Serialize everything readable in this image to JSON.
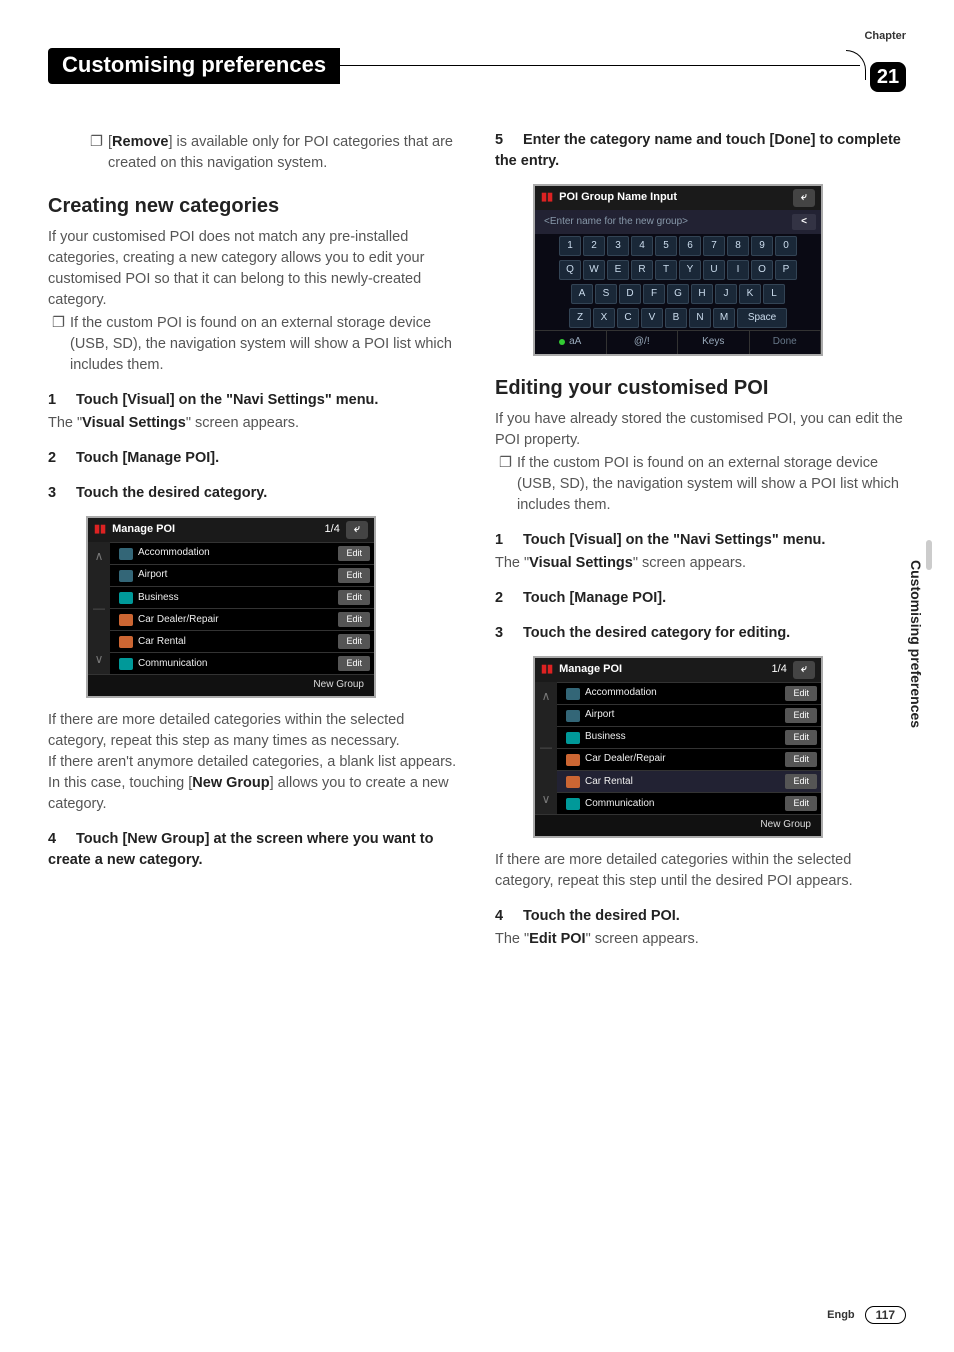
{
  "header": {
    "chapter_label": "Chapter",
    "title": "Customising preferences",
    "chapter_num": "21"
  },
  "col1": {
    "remove_note_prefix": "[",
    "remove_bold": "Remove",
    "remove_note_rest": "] is available only for POI categories that are created on this navigation system.",
    "heading1": "Creating new categories",
    "p1": "If your customised POI does not match any pre-installed categories, creating a new category allows you to edit your customised POI so that it can belong to this newly-created category.",
    "bullet1": "If the custom POI is found on an external storage device (USB, SD), the navigation system will show a POI list which includes them.",
    "step1": "Touch [Visual] on the \"Navi Settings\" menu.",
    "step1_note_a": "The \"",
    "step1_note_bold": "Visual Settings",
    "step1_note_b": "\" screen appears.",
    "step2": "Touch [Manage POI].",
    "step3": "Touch the desired category.",
    "shot1": {
      "title": "Manage POI",
      "page": "1/4",
      "rows": [
        {
          "label": "Accommodation",
          "btn": "Edit"
        },
        {
          "label": "Airport",
          "btn": "Edit"
        },
        {
          "label": "Business",
          "btn": "Edit"
        },
        {
          "label": "Car Dealer/Repair",
          "btn": "Edit"
        },
        {
          "label": "Car Rental",
          "btn": "Edit"
        },
        {
          "label": "Communication",
          "btn": "Edit"
        }
      ],
      "footer": "New Group"
    },
    "p2": "If there are more detailed categories within the selected category, repeat this step as many times as necessary.",
    "p3a": "If there aren't anymore detailed categories, a blank list appears. In this case, touching [",
    "p3bold": "New Group",
    "p3b": "] allows you to create a new category.",
    "step4": "Touch [New Group] at the screen where you want to create a new category."
  },
  "col2": {
    "step5": "Enter the category name and touch [Done] to complete the entry.",
    "kb": {
      "title": "POI Group Name Input",
      "placeholder": "<Enter name for the new group>",
      "row1": [
        "1",
        "2",
        "3",
        "4",
        "5",
        "6",
        "7",
        "8",
        "9",
        "0"
      ],
      "row2": [
        "Q",
        "W",
        "E",
        "R",
        "T",
        "Y",
        "U",
        "I",
        "O",
        "P"
      ],
      "row3": [
        "A",
        "S",
        "D",
        "F",
        "G",
        "H",
        "J",
        "K",
        "L"
      ],
      "row4": [
        "Z",
        "X",
        "C",
        "V",
        "B",
        "N",
        "M",
        "Space"
      ],
      "bottom": [
        "aA",
        "@/!",
        "Keys",
        "Done"
      ]
    },
    "heading2": "Editing your customised POI",
    "p4": "If you have already stored the customised POI, you can edit the POI property.",
    "bullet2": "If the custom POI is found on an external storage device (USB, SD), the navigation system will show a POI list which includes them.",
    "step1b": "Touch [Visual] on the \"Navi Settings\" menu.",
    "step1b_note_a": "The \"",
    "step1b_note_bold": "Visual Settings",
    "step1b_note_b": "\" screen appears.",
    "step2b": "Touch [Manage POI].",
    "step3b": "Touch the desired category for editing.",
    "shot2": {
      "title": "Manage POI",
      "page": "1/4",
      "rows": [
        {
          "label": "Accommodation",
          "btn": "Edit"
        },
        {
          "label": "Airport",
          "btn": "Edit"
        },
        {
          "label": "Business",
          "btn": "Edit"
        },
        {
          "label": "Car Dealer/Repair",
          "btn": "Edit"
        },
        {
          "label": "Car Rental",
          "btn": "Edit"
        },
        {
          "label": "Communication",
          "btn": "Edit"
        }
      ],
      "footer": "New Group"
    },
    "p5": "If there are more detailed categories within the selected category, repeat this step until the desired POI appears.",
    "step4b": "Touch the desired POI.",
    "step4b_note_a": "The \"",
    "step4b_note_bold": "Edit POI",
    "step4b_note_b": "\" screen appears."
  },
  "side_tab": "Customising preferences",
  "footer": {
    "lang": "Engb",
    "page": "117"
  }
}
